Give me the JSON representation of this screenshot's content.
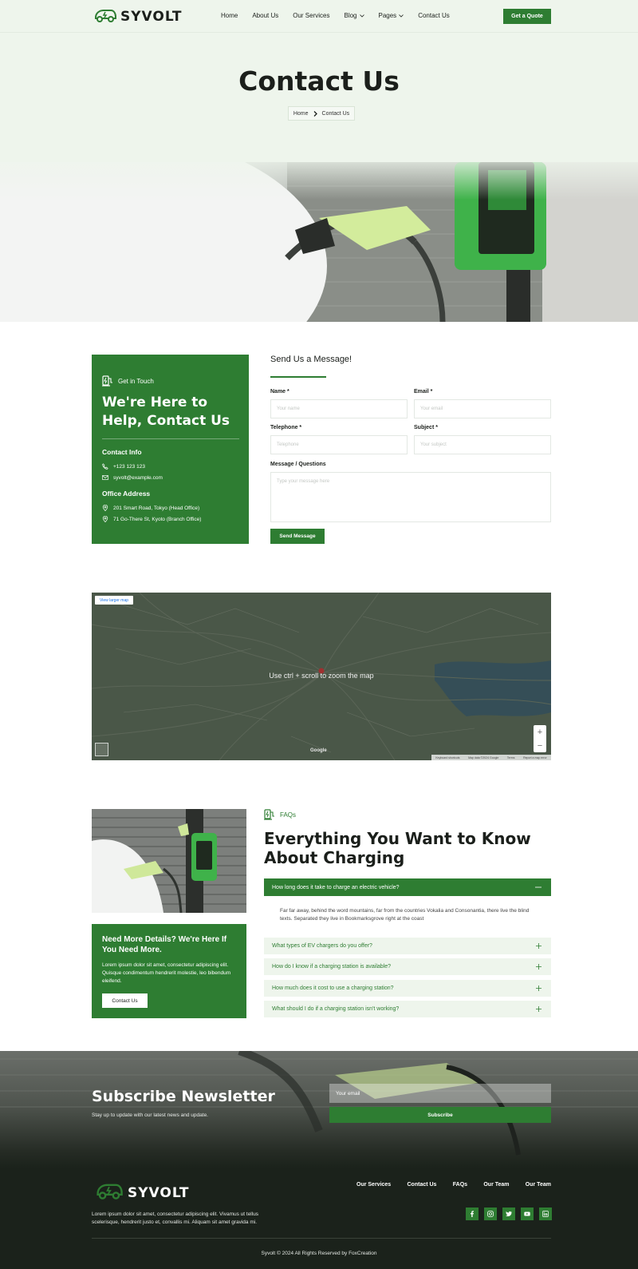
{
  "header": {
    "brand": "SYVOLT",
    "nav": [
      {
        "label": "Home",
        "active": false,
        "dropdown": false
      },
      {
        "label": "About Us",
        "active": false,
        "dropdown": false
      },
      {
        "label": "Our Services",
        "active": false,
        "dropdown": false
      },
      {
        "label": "Blog",
        "active": false,
        "dropdown": true
      },
      {
        "label": "Pages",
        "active": false,
        "dropdown": true
      },
      {
        "label": "Contact Us",
        "active": true,
        "dropdown": false
      }
    ],
    "cta": "Get a Quote"
  },
  "hero": {
    "title": "Contact Us",
    "breadcrumb": {
      "home": "Home",
      "current": "Contact Us"
    }
  },
  "contact_info": {
    "tag": "Get in Touch",
    "heading": "We're Here to Help, Contact Us",
    "contact_heading": "Contact Info",
    "phone": "+123 123 123",
    "email": "syvolt@example.com",
    "office_heading": "Office Address",
    "address_1": "201 Smart Road, Tokyo (Head Office)",
    "address_2": "71 Go-There St, Kyoto (Branch Office)"
  },
  "form": {
    "title": "Send Us a Message!",
    "name_label": "Name *",
    "name_placeholder": "Your name",
    "email_label": "Email *",
    "email_placeholder": "Your email",
    "phone_label": "Telephone *",
    "phone_placeholder": "Telephone",
    "subject_label": "Subject *",
    "subject_placeholder": "Your subject",
    "message_label": "Message / Questions",
    "message_placeholder": "Type your message here",
    "submit": "Send Message"
  },
  "map": {
    "larger_map": "View larger map",
    "hint": "Use ctrl + scroll to zoom the map",
    "zoom_in": "+",
    "zoom_out": "−",
    "footer": [
      "Keyboard shortcuts",
      "Map data ©2024 Google",
      "Terms",
      "Report a map error"
    ],
    "google": "Google"
  },
  "faq": {
    "side_heading": "Need More Details? We're Here If You Need More.",
    "side_text": "Lorem ipsum dolor sit amet, consectetur adipiscing elit. Quisque condimentum hendrerit molestie, leo bibendum eleifend.",
    "side_button": "Contact Us",
    "tag": "FAQs",
    "title": "Everything You Want to Know About Charging",
    "items": [
      {
        "q": "How long does it take to charge an electric vehicle?",
        "open": true
      },
      {
        "q": "What types of EV chargers do you offer?",
        "open": false
      },
      {
        "q": "How do I know if a charging station is available?",
        "open": false
      },
      {
        "q": "How much does it cost to use a charging station?",
        "open": false
      },
      {
        "q": "What should I do if a charging station isn't working?",
        "open": false
      }
    ],
    "answer": "Far far away, behind the word mountains, far from the countries Vokalia and Consonantia, there live the blind texts. Separated they live in Bookmarksgrove right at the coast"
  },
  "newsletter": {
    "title": "Subscribe Newsletter",
    "subtitle": "Stay up to update with our latest news and update.",
    "placeholder": "Your email",
    "button": "Subscribe"
  },
  "footer": {
    "brand": "SYVOLT",
    "description": "Lorem ipsum dolor sit amet, consectetur adipiscing elit. Vivamus ut tellus scelerisque, hendrerit justo et, convallis mi. Aliquam sit amet gravida mi.",
    "links": [
      "Our Services",
      "Contact Us",
      "FAQs",
      "Our Team",
      "Our Team"
    ],
    "social_icons": [
      "facebook-icon",
      "instagram-icon",
      "twitter-icon",
      "youtube-icon",
      "linkedin-icon"
    ],
    "copyright": "Syvolt © 2024 All Rights Reserved by FoxCreation"
  },
  "colors": {
    "brand_green": "#2e7d32",
    "light_green_bg": "#eef5ec",
    "footer_bg": "#1b221b"
  }
}
